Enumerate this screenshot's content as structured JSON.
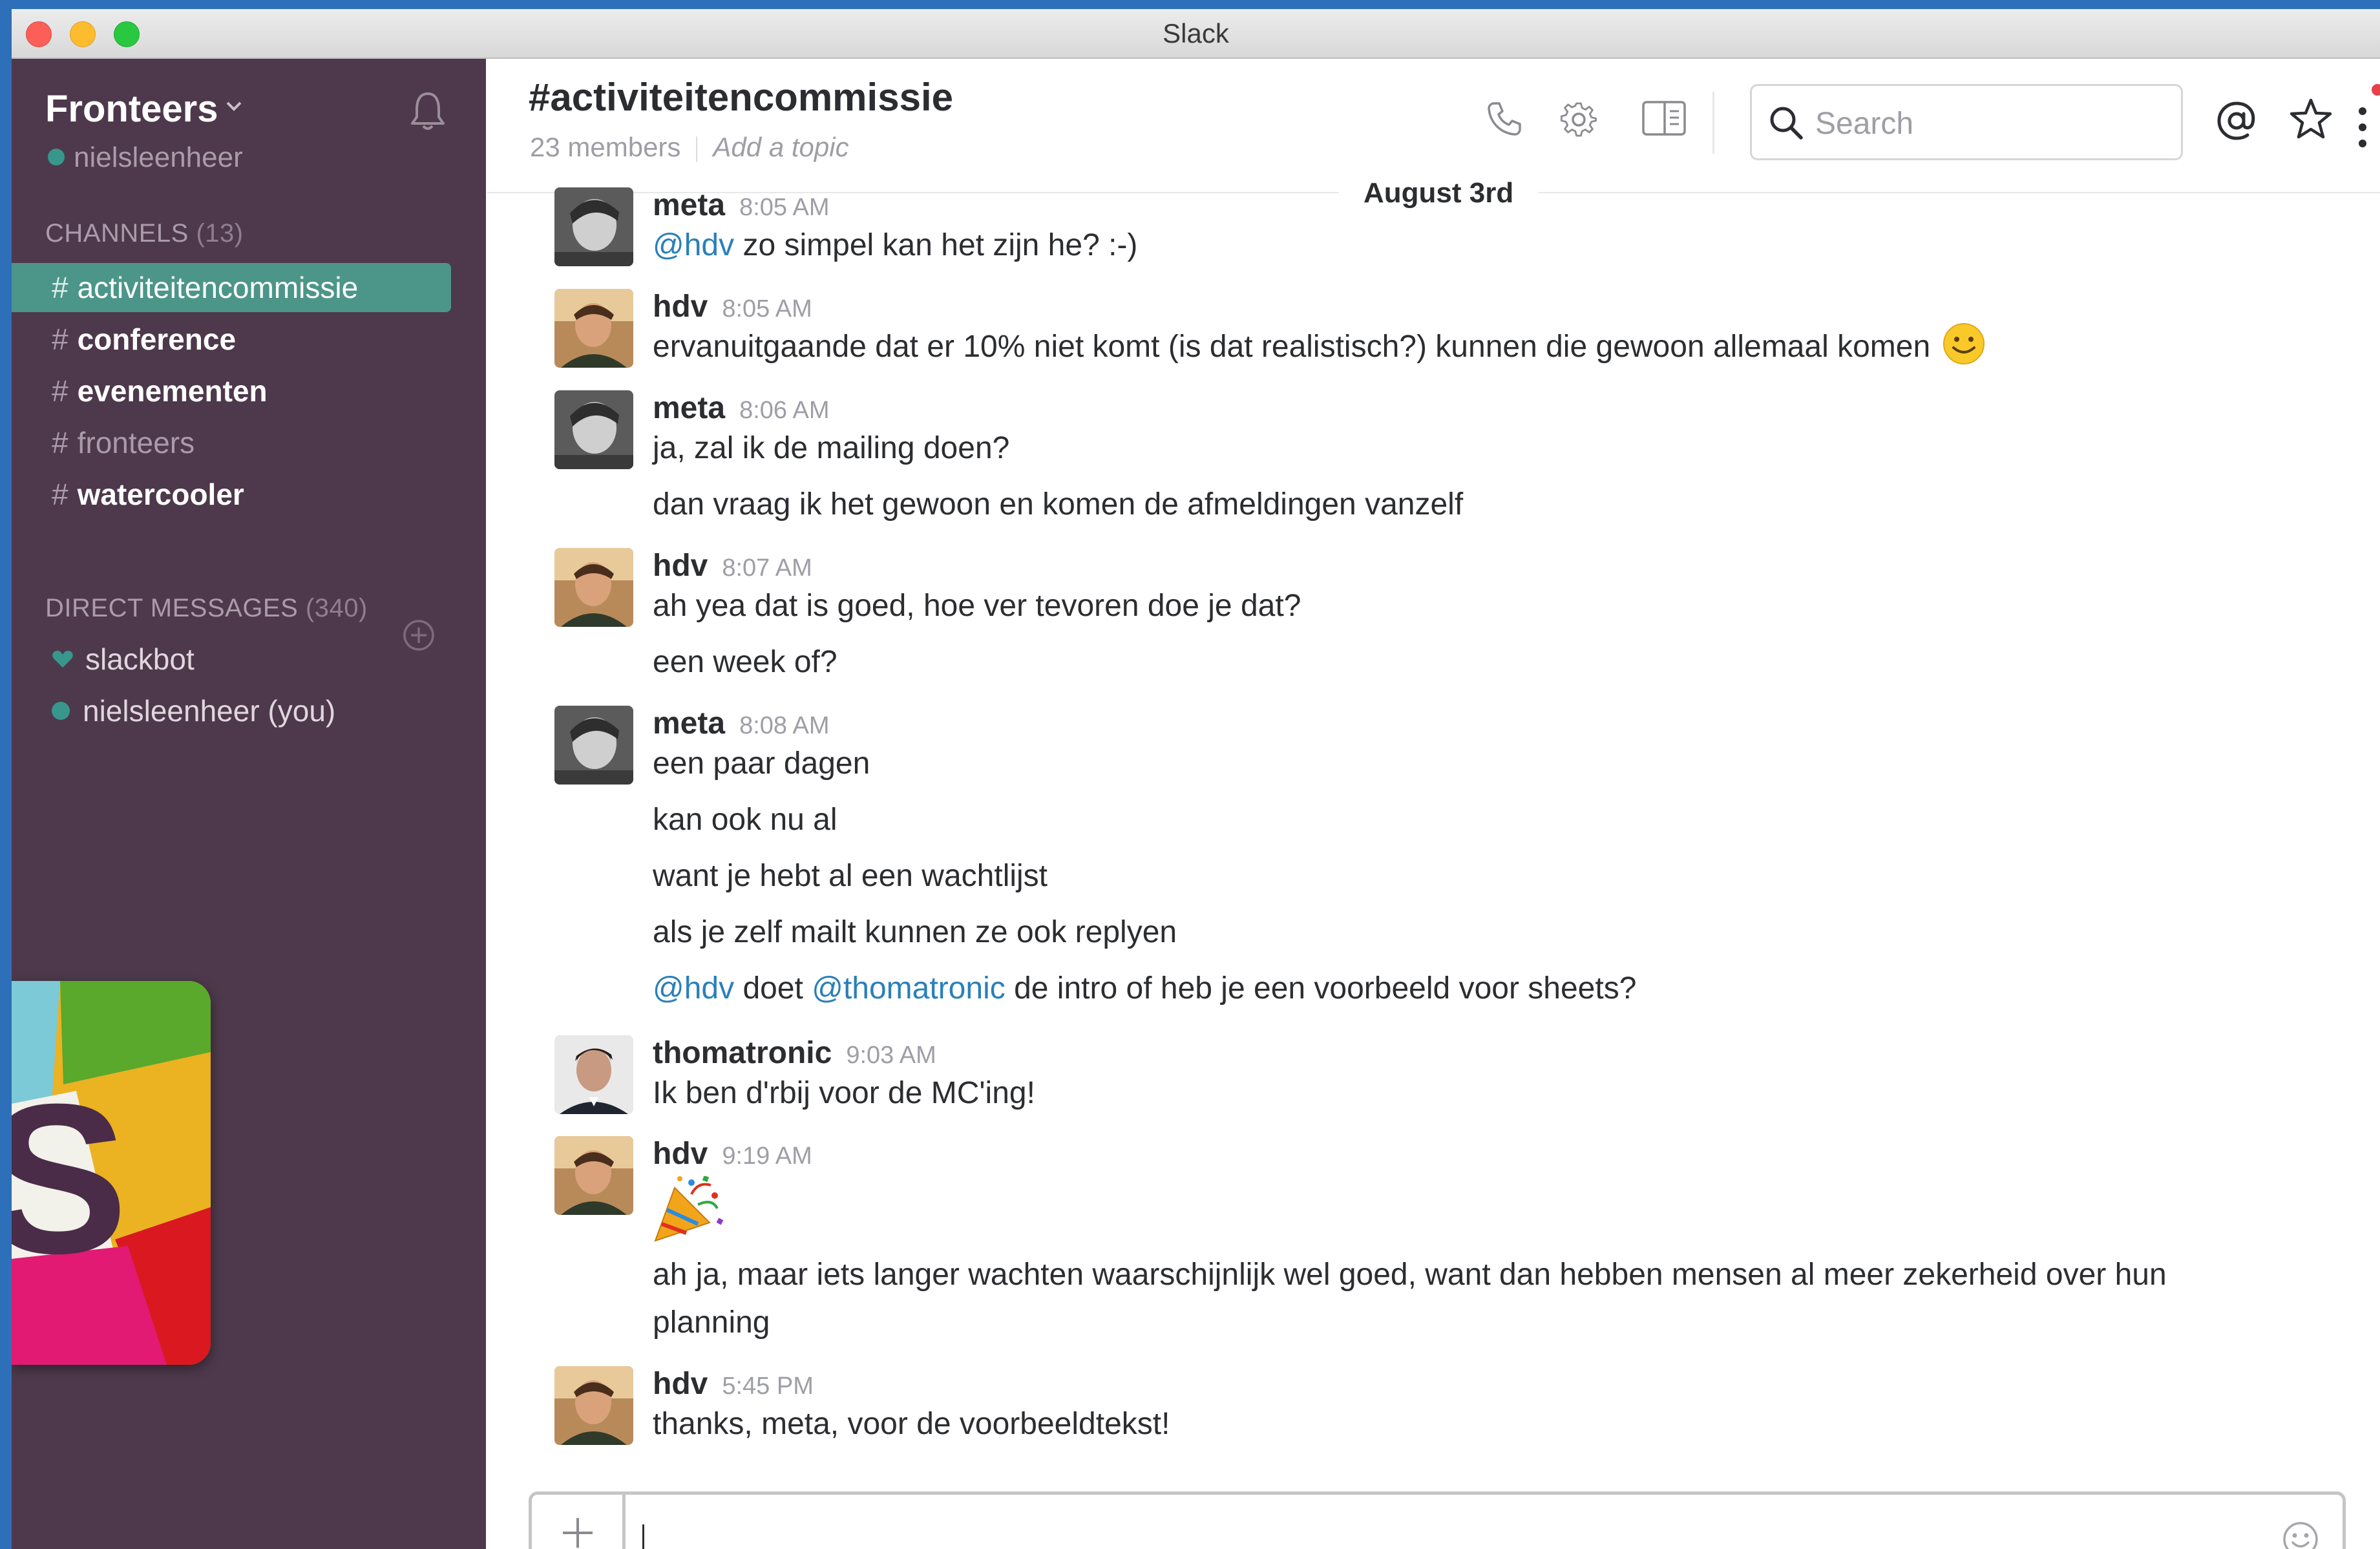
{
  "window": {
    "title": "Slack"
  },
  "sidebar": {
    "team_name": "Fronteers",
    "user": "nielsleenheer",
    "channels_header": "CHANNELS",
    "channels_count": "(13)",
    "channels": [
      {
        "name": "activiteitencommissie",
        "state": "active"
      },
      {
        "name": "conference",
        "state": "unread"
      },
      {
        "name": "evenementen",
        "state": "unread"
      },
      {
        "name": "fronteers",
        "state": "read"
      },
      {
        "name": "watercooler",
        "state": "unread"
      }
    ],
    "dm_header": "DIRECT MESSAGES",
    "dm_count": "(340)",
    "dms": [
      {
        "name": "slackbot",
        "icon": "heart-icon"
      },
      {
        "name": "nielsleenheer (you)",
        "icon": "presence-dot"
      }
    ]
  },
  "header": {
    "channel": "#activiteitencommissie",
    "members": "23 members",
    "topic": "Add a topic",
    "search_placeholder": "Search"
  },
  "day_divider": "August 3rd",
  "messages": [
    {
      "sender": "meta",
      "time": "8:05 AM",
      "lines": [
        {
          "mention": "@hdv",
          "text": " zo simpel kan het zijn he? :-)"
        }
      ]
    },
    {
      "sender": "hdv",
      "time": "8:05 AM",
      "lines": [
        {
          "text": "ervanuitgaande dat er 10% niet komt (is dat realistisch?) kunnen die gewoon allemaal komen"
        }
      ]
    },
    {
      "sender": "meta",
      "time": "8:06 AM",
      "lines": [
        {
          "text": "ja, zal ik de mailing doen?"
        },
        {
          "text": "dan vraag ik het gewoon en komen de afmeldingen vanzelf"
        }
      ]
    },
    {
      "sender": "hdv",
      "time": "8:07 AM",
      "lines": [
        {
          "text": "ah yea dat is goed, hoe ver tevoren doe je dat?"
        },
        {
          "text": "een week of?"
        }
      ]
    },
    {
      "sender": "meta",
      "time": "8:08 AM",
      "lines": [
        {
          "text": "een paar dagen"
        },
        {
          "text": "kan ook nu al"
        },
        {
          "text": "want je hebt al een wachtlijst"
        },
        {
          "text": "als je zelf mailt kunnen ze ook replyen"
        },
        {
          "mention": "@hdv",
          "text": " doet ",
          "mention2": "@thomatronic",
          "text2": " de intro of heb je een voorbeeld voor sheets?"
        }
      ]
    },
    {
      "sender": "thomatronic",
      "time": "9:03 AM",
      "lines": [
        {
          "text": "Ik ben d'rbij voor de MC'ing!"
        }
      ]
    },
    {
      "sender": "hdv",
      "time": "9:19 AM",
      "lines": [
        {
          "text": "ah ja, maar iets langer wachten waarschijnlijk wel goed, want dan hebben mensen al meer zekerheid over hun planning"
        }
      ]
    },
    {
      "sender": "hdv",
      "time": "5:45 PM",
      "lines": [
        {
          "text": "thanks, meta, voor de voorbeeldtekst!"
        }
      ]
    }
  ],
  "composer": {
    "placeholder": ""
  },
  "colors": {
    "sidebar": "#4d394b",
    "active_channel": "#4c9689",
    "mention": "#2a80b9",
    "presence": "#38978d"
  }
}
